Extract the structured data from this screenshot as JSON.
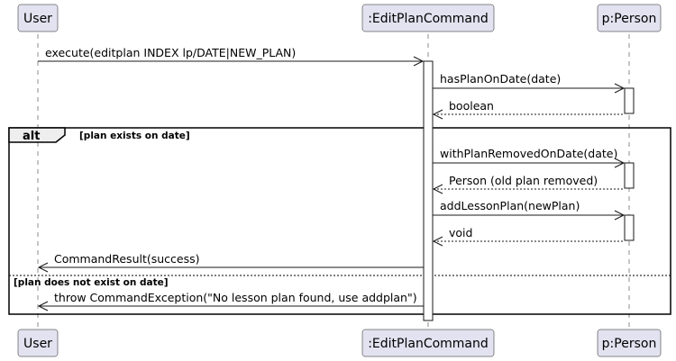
{
  "participants": {
    "user": "User",
    "editplan": ":EditPlanCommand",
    "person": "p:Person"
  },
  "messages": {
    "execute": "execute(editplan INDEX lp/DATE|NEW_PLAN)",
    "has_plan": "hasPlanOnDate(date)",
    "boolean_return": "boolean",
    "with_plan_removed": "withPlanRemovedOnDate(date)",
    "person_return": "Person (old plan removed)",
    "add_lesson_plan": "addLessonPlan(newPlan)",
    "void_return": "void",
    "command_result": "CommandResult(success)",
    "throw_exception": "throw CommandException(\"No lesson plan found, use addplan\")"
  },
  "fragment": {
    "label": "alt",
    "guard_1": "[plan exists on date]",
    "guard_2": "[plan does not exist on date]"
  }
}
